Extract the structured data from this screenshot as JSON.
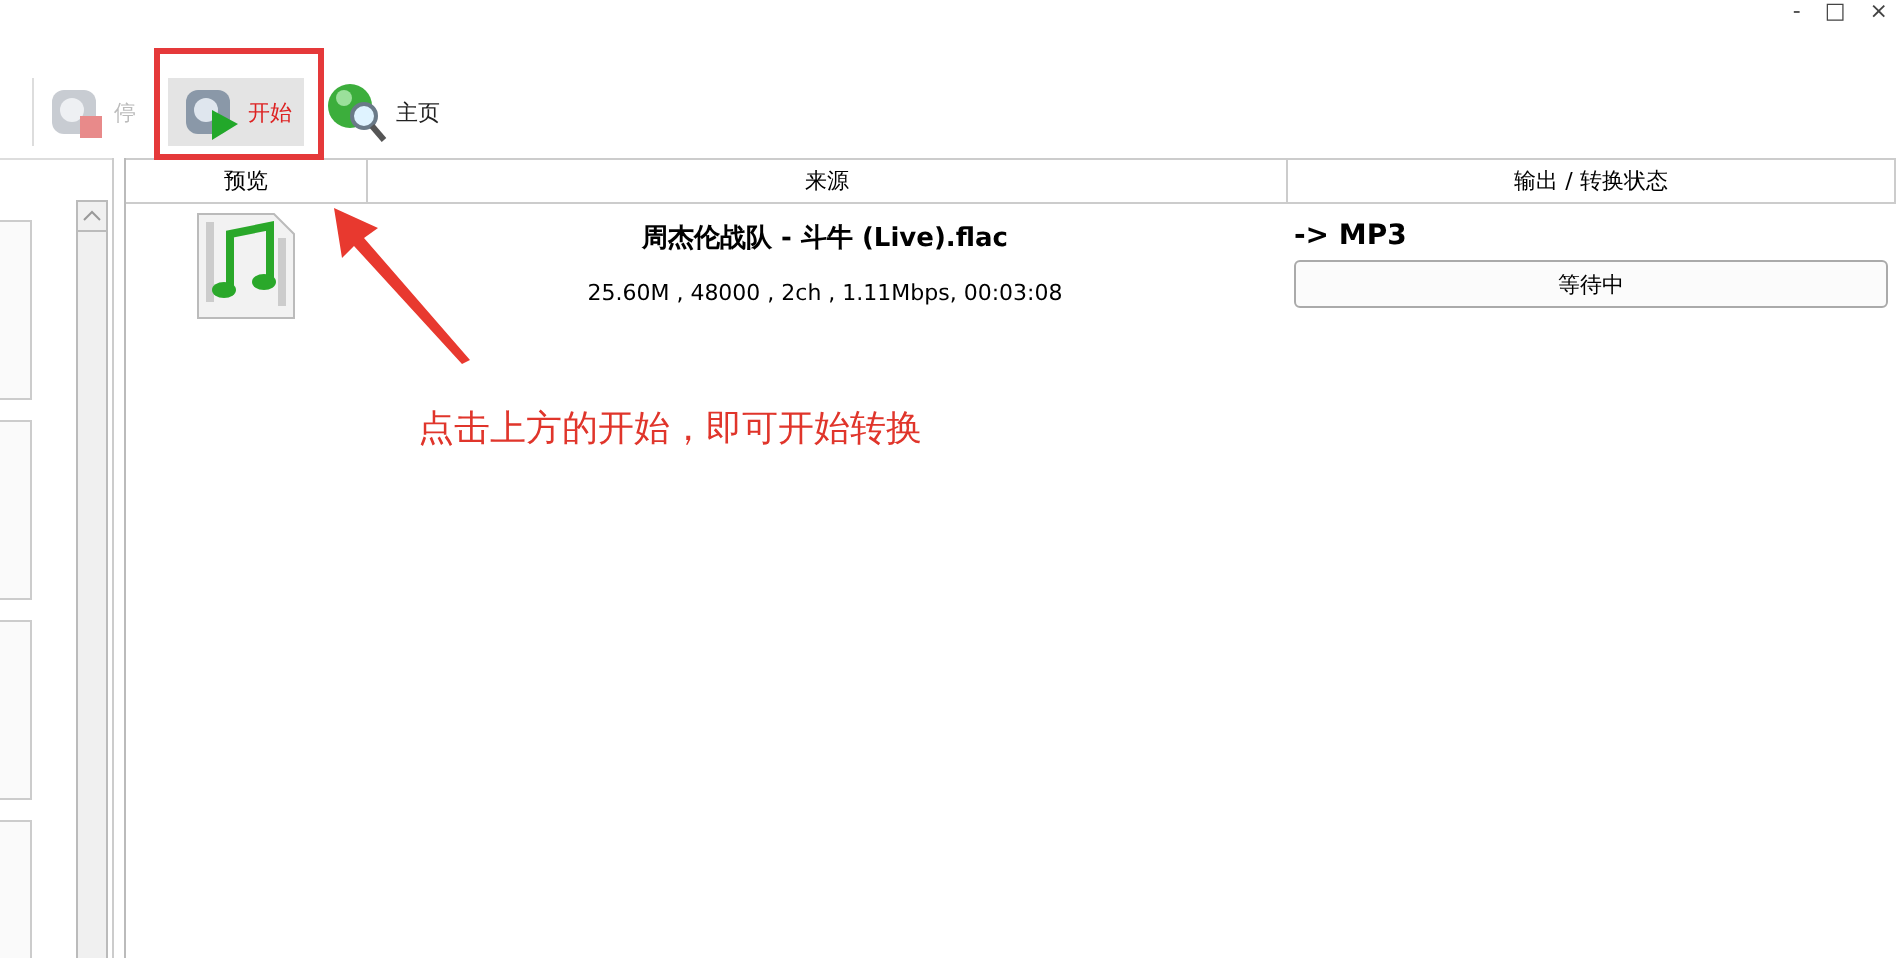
{
  "window_controls": [
    "-",
    "□",
    "×"
  ],
  "toolbar": [
    {
      "label": "停",
      "kind": "stop",
      "disabled": true,
      "selected": false
    },
    {
      "label": "开始",
      "kind": "start",
      "disabled": false,
      "selected": true
    },
    {
      "label": "主页",
      "kind": "home",
      "disabled": false,
      "selected": false
    }
  ],
  "table": {
    "columns": [
      "预览",
      "来源",
      "输出 / 转换状态"
    ],
    "rows": [
      {
        "title": "周杰伦战队 - 斗牛 (Live).flac",
        "details": "25.60M , 48000 , 2ch , 1.11Mbps, 00:03:08",
        "output": "-> MP3",
        "status": "等待中"
      }
    ]
  },
  "annotation": {
    "text": "点击上方的开始，即可开始转换"
  }
}
